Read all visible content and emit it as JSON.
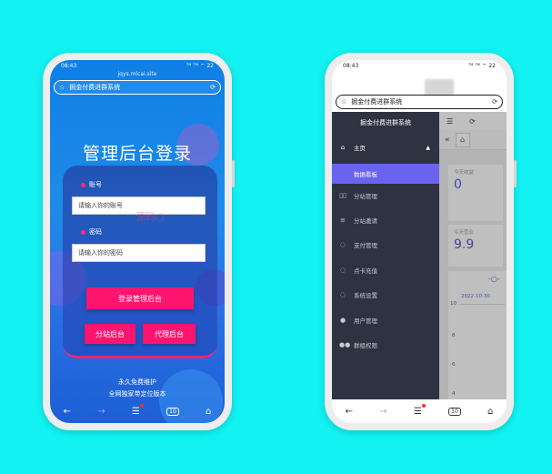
{
  "left_phone": {
    "status": {
      "time": "08:43",
      "icons": "ᵀᴹ ᵀᴹ ⌔ 22"
    },
    "url": "jqys.mlcai.site",
    "address_bar": {
      "title": "掘金付费进群系统"
    },
    "login_title": "管理后台登录",
    "account_label": "账号",
    "account_placeholder": "请输入你的账号",
    "password_label": "密码",
    "password_placeholder": "请输入你的密码",
    "watermark": "源码○",
    "login_button": "登录管理后台",
    "branch_button": "分站后台",
    "agent_button": "代理后台",
    "footer_line1": "永久免费维护",
    "footer_line2": "全网独家带定位版本",
    "nav": {
      "back": "←",
      "forward": "→",
      "menu": "☰",
      "tabs": "10",
      "home": "⌂"
    }
  },
  "right_phone": {
    "status": {
      "time": "08:43",
      "icons": "ᵀᴹ ᵀᴹ ⌔ 22"
    },
    "address_bar": {
      "title": "掘金付费进群系统"
    },
    "sidebar": {
      "title": "掘金付费进群系统",
      "home": "主页",
      "active": "数据看板",
      "items": [
        "分站管理",
        "分站邀请",
        "支付管理",
        "点卡充值",
        "系统设置",
        "用户管理",
        "群组权限"
      ]
    },
    "toolbar": {
      "menu": "☰",
      "refresh": "⟳",
      "collapse": "«",
      "home_tab": "⌂"
    },
    "stats": [
      {
        "label": "今天收益",
        "value": "0"
      },
      {
        "label": "今天营业",
        "value": "9.9"
      }
    ],
    "chart": {
      "date": "2022-10-30",
      "y_ticks": [
        "10",
        "8",
        "6",
        "4"
      ]
    },
    "nav": {
      "back": "←",
      "forward": "→",
      "menu": "☰",
      "tabs": "10",
      "home": "⌂"
    }
  }
}
